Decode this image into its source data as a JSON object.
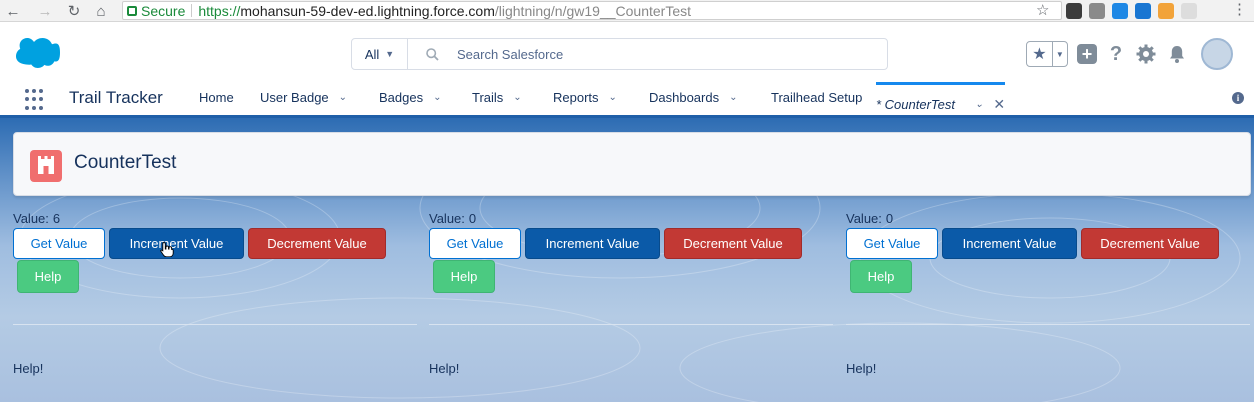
{
  "browser": {
    "secure_label": "Secure",
    "url_scheme": "https://",
    "url_host": "mohansun-59-dev-ed.lightning.force.com",
    "url_path": "/lightning/n/gw19__CounterTest",
    "extensions": [
      {
        "name": "ext-dark",
        "color": "#3c3c3c"
      },
      {
        "name": "ext-grey",
        "color": "#8a8a8a"
      },
      {
        "name": "ext-blue-s",
        "color": "#1e88e5"
      },
      {
        "name": "ext-sd",
        "color": "#1976d2"
      },
      {
        "name": "ext-orange",
        "color": "#f2a33a"
      },
      {
        "name": "ext-light",
        "color": "#dddddd"
      }
    ]
  },
  "header": {
    "search_scope": "All",
    "search_placeholder": "Search Salesforce"
  },
  "nav": {
    "app_name": "Trail Tracker",
    "items": [
      {
        "label": "Home",
        "has_menu": false
      },
      {
        "label": "User Badge",
        "has_menu": true
      },
      {
        "label": "Badges",
        "has_menu": true
      },
      {
        "label": "Trails",
        "has_menu": true
      },
      {
        "label": "Reports",
        "has_menu": true
      },
      {
        "label": "Dashboards",
        "has_menu": true
      },
      {
        "label": "Trailhead Setup",
        "has_menu": false
      }
    ],
    "active_tab": "* CounterTest"
  },
  "page": {
    "title": "CounterTest"
  },
  "counters": [
    {
      "value_label": "Value:",
      "value": "6",
      "get": "Get Value",
      "increment": "Increment Value",
      "decrement": "Decrement Value",
      "help": "Help",
      "help_text": "Help!"
    },
    {
      "value_label": "Value:",
      "value": "0",
      "get": "Get Value",
      "increment": "Increment Value",
      "decrement": "Decrement Value",
      "help": "Help",
      "help_text": "Help!"
    },
    {
      "value_label": "Value:",
      "value": "0",
      "get": "Get Value",
      "increment": "Increment Value",
      "decrement": "Decrement Value",
      "help": "Help",
      "help_text": "Help!"
    }
  ],
  "colors": {
    "brand": "#0b5aa8",
    "destructive": "#c23934",
    "success": "#4bca81",
    "tab_icon": "#f06e6e"
  }
}
